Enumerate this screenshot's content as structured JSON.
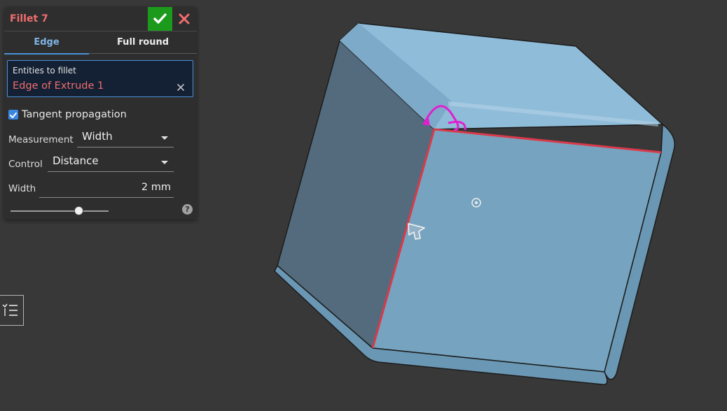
{
  "feature_dialog": {
    "title": "Fillet 7",
    "tabs": [
      "Edge",
      "Full round"
    ],
    "entities": {
      "label": "Entities to fillet",
      "value": "Edge of Extrude 1"
    },
    "tangent_propagation": {
      "label": "Tangent propagation",
      "checked": true
    },
    "measurement": {
      "label": "Measurement",
      "value": "Width"
    },
    "control": {
      "label": "Control",
      "value": "Distance"
    },
    "width": {
      "label": "Width",
      "value": "2 mm"
    },
    "slider_level": 0.69,
    "help_glyph": "?"
  },
  "icons": {
    "accept": "check-icon",
    "cancel": "close-icon",
    "clear": "close-icon",
    "feature_list": "list-icon",
    "cursor": "arrow-cursor-icon",
    "origin": "origin-point-icon"
  },
  "colors": {
    "background": "#383838",
    "panel": "#2e2e2e",
    "accent_blue": "#4a90d9",
    "title_red": "#f26d6d",
    "accept_green": "#1b9a1b",
    "selected_edge": "#d93a4a",
    "manipulator": "#e020d0",
    "part_face_top": "#8fbcd9",
    "part_face_front": "#76a4c0",
    "part_face_left": "#536b7d"
  }
}
